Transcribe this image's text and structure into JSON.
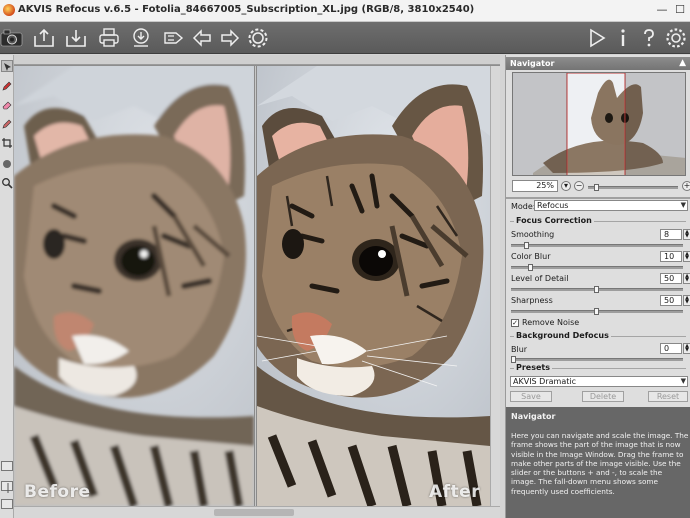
{
  "window": {
    "title": "AKVIS Refocus v.6.5 - Fotolia_84667005_Subscription_XL.jpg (RGB/8, 3810x2540)",
    "minimize_glyph": "—",
    "maximize_glyph": "☐"
  },
  "toolbar": {
    "left_icons": [
      "camera-icon",
      "open-image-icon",
      "save-image-icon",
      "print-icon",
      "share-icon",
      "batch-icon",
      "undo-icon",
      "redo-icon",
      "settings-gear-icon"
    ],
    "right_icons": [
      "run-icon",
      "info-icon",
      "help-icon",
      "preferences-icon"
    ]
  },
  "left_tools": [
    "navigator-tool-icon",
    "pencil-icon",
    "eraser-icon",
    "brush-icon",
    "crop-icon",
    "hand-icon",
    "zoom-icon"
  ],
  "canvas": {
    "before_label": "Before",
    "after_label": "After"
  },
  "navigator": {
    "header": "Navigator",
    "zoom_value": "25%",
    "zoom_out": "−",
    "zoom_in": "+"
  },
  "settings": {
    "mode_label": "Mode:",
    "mode_value": "Refocus",
    "focus_correction_title": "Focus Correction",
    "params": [
      {
        "label": "Smoothing",
        "value": "8",
        "level": 0.08
      },
      {
        "label": "Color Blur",
        "value": "10",
        "level": 0.1
      },
      {
        "label": "Level of Detail",
        "value": "50",
        "level": 0.5
      },
      {
        "label": "Sharpness",
        "value": "50",
        "level": 0.5
      }
    ],
    "remove_noise_label": "Remove Noise",
    "remove_noise_checked": true,
    "background_defocus_title": "Background Defocus",
    "blur_label": "Blur",
    "blur_value": "0",
    "blur_level": 0.0
  },
  "presets": {
    "title": "Presets",
    "selected": "AKVIS Dramatic",
    "save_label": "Save",
    "delete_label": "Delete",
    "reset_label": "Reset"
  },
  "help": {
    "title": "Navigator",
    "text": "Here you can navigate and scale the image. The frame shows the part of the image that is now visible in the Image Window. Drag the frame to make other parts of the image visible. Use the slider or the buttons + and -, to scale the image. The fall-down menu shows some frequently used coefficients."
  },
  "colors": {
    "toolbar": "#5e5e5e",
    "panel_header": "#808080",
    "help_bg": "#676767"
  }
}
